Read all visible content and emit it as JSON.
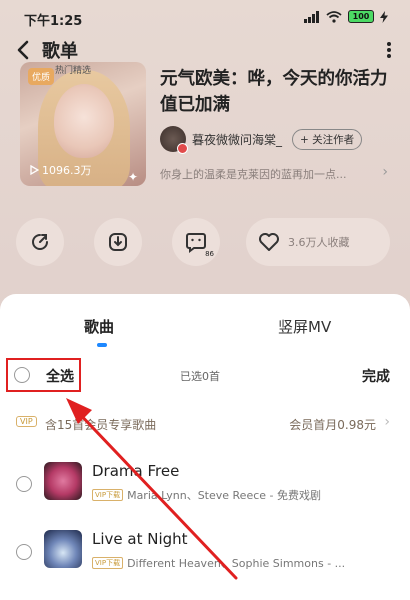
{
  "status": {
    "time": "下午1:25",
    "battery": "100"
  },
  "nav": {
    "title": "歌单"
  },
  "playlist": {
    "cover_tag": "优质",
    "cover_subtitle": "热门精选",
    "play_count": "1096.3万",
    "title": "元气欧美：哗，今天的你活力值已加满",
    "creator_name": "暮夜微微问海棠_",
    "follow_label": "+ 关注作者",
    "description": "你身上的温柔是克莱因的蓝再加一点..."
  },
  "actions": {
    "comment_count": "86",
    "collect_label": "3.6万人收藏"
  },
  "sheet": {
    "tabs": [
      {
        "label": "歌曲"
      },
      {
        "label": "竖屏MV"
      }
    ],
    "select_all_label": "全选",
    "selected_count": "已选0首",
    "done_label": "完成",
    "vip_tag": "VIP",
    "vip_text": "含15首会员专享歌曲",
    "vip_price": "会员首月0.98元"
  },
  "songs": [
    {
      "title": "Drama Free",
      "vip_tag": "VIP下载",
      "artist": "Maria Lynn、Steve Reece - 免费戏剧"
    },
    {
      "title": "Live at Night",
      "vip_tag": "VIP下载",
      "artist": "Different Heaven、Sophie Simmons - ..."
    }
  ],
  "colors": {
    "annotation_red": "#e02020",
    "accent_blue": "#1e88ff",
    "vip_gold": "#c89a3a"
  }
}
